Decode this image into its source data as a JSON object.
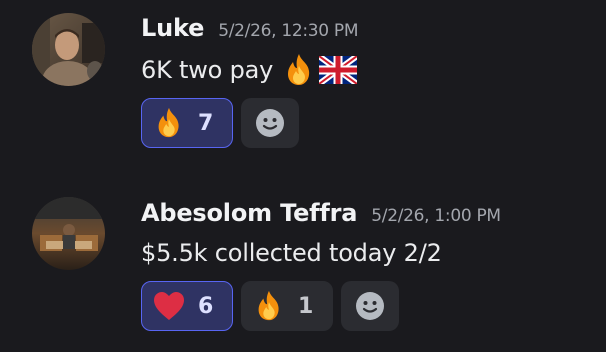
{
  "messages": [
    {
      "username": "Luke",
      "timestamp": "5/2/26, 12:30 PM",
      "text": "6K two pay",
      "inline_emojis": [
        "fire-icon",
        "uk-flag-icon"
      ],
      "reactions": [
        {
          "emoji": "fire-icon",
          "count": "7",
          "active": true
        }
      ],
      "add_reaction_icon": "smiley-icon"
    },
    {
      "username": "Abesolom Teffra",
      "timestamp": "5/2/26, 1:00 PM",
      "text": "$5.5k collected today 2/2",
      "inline_emojis": [],
      "reactions": [
        {
          "emoji": "heart-icon",
          "count": "6",
          "active": true
        },
        {
          "emoji": "fire-icon",
          "count": "1",
          "active": false
        }
      ],
      "add_reaction_icon": "smiley-icon"
    }
  ],
  "colors": {
    "background": "#1a1a1e",
    "reaction_active_bg": "#2f3363",
    "reaction_active_border": "#5865f2",
    "reaction_bg": "#2b2c31"
  }
}
